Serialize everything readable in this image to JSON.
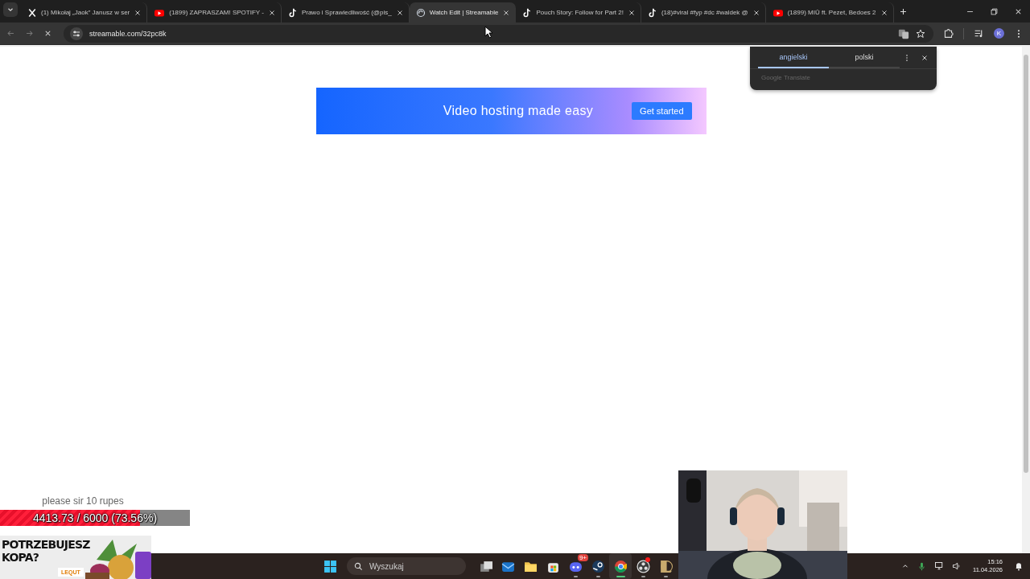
{
  "tabs": [
    {
      "kind": "x",
      "title": "(1) Mikołaj „Jaok” Janusz w ser",
      "selected": false
    },
    {
      "kind": "youtube",
      "title": "(1899) ZAPRASZAM! SPOTIFY -",
      "selected": false
    },
    {
      "kind": "tiktok",
      "title": "Prawo i Sprawiedliwość (@pis_",
      "selected": false
    },
    {
      "kind": "streamable",
      "title": "Watch Edit | Streamable",
      "selected": true
    },
    {
      "kind": "tiktok",
      "title": "Pouch Story: Follow for Part 2!",
      "selected": false
    },
    {
      "kind": "tiktok",
      "title": "(18)#viral #fyp #dc #waldek @",
      "selected": false
    },
    {
      "kind": "youtube",
      "title": "(1899) MIŪ ft. Pezet, Bedoes 2",
      "selected": false
    }
  ],
  "toolbar": {
    "url": "streamable.com/32pc8k",
    "loading": true,
    "profile_initial": "K"
  },
  "translate_popup": {
    "languages": [
      {
        "label": "angielski",
        "selected": true
      },
      {
        "label": "polski",
        "selected": false
      }
    ],
    "footer": "Google Translate"
  },
  "banner": {
    "headline": "Video hosting made easy",
    "button": "Get started"
  },
  "overlay": {
    "goal_title": "please sir 10 rupes",
    "goal_progress": "4413.73 / 6000 (73.56%)",
    "level": 0.7356,
    "ad": {
      "headline": "POTRZEBUJESZ KOPA?",
      "code": "LEQUT"
    }
  },
  "taskbar": {
    "search_placeholder": "Wyszukaj",
    "apps": [
      {
        "kind": "taskview",
        "running": false,
        "active": false,
        "alert": false
      },
      {
        "kind": "mail",
        "running": false,
        "active": false,
        "alert": false
      },
      {
        "kind": "folder",
        "running": false,
        "active": false,
        "alert": false
      },
      {
        "kind": "store",
        "running": false,
        "active": false,
        "alert": false
      },
      {
        "kind": "discord",
        "running": true,
        "active": false,
        "alert": false,
        "badge": "9+"
      },
      {
        "kind": "steam",
        "running": true,
        "active": false,
        "alert": false
      },
      {
        "kind": "chrome",
        "running": true,
        "active": true,
        "alert": false
      },
      {
        "kind": "obs",
        "running": true,
        "active": false,
        "alert": true
      },
      {
        "kind": "league",
        "running": true,
        "active": false,
        "alert": false
      }
    ],
    "time": "15:16",
    "date": "11.04.2026"
  }
}
